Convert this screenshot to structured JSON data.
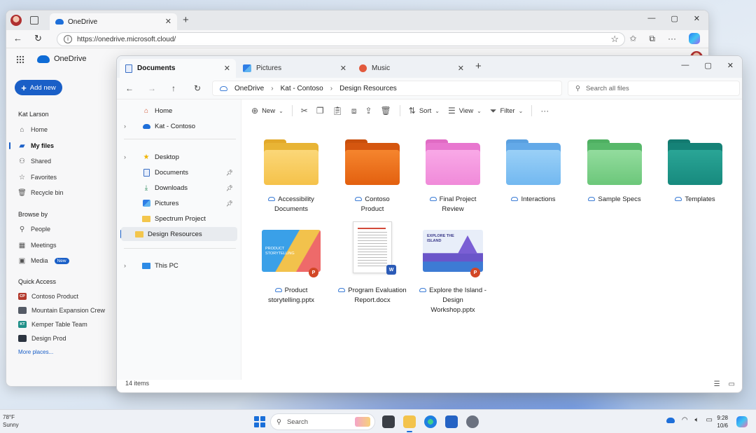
{
  "browser": {
    "tab_title": "OneDrive",
    "url": "https://onedrive.microsoft.cloud/",
    "new_tab": "+",
    "window_controls": [
      "—",
      "▢",
      "✕"
    ]
  },
  "onedrive": {
    "app_name": "OneDrive",
    "add_new": "Add new",
    "user_name": "Kat Larson",
    "nav": [
      {
        "label": "Home",
        "icon": "home-icon"
      },
      {
        "label": "My files",
        "icon": "folder-icon"
      },
      {
        "label": "Shared",
        "icon": "people-icon"
      },
      {
        "label": "Favorites",
        "icon": "star-icon"
      },
      {
        "label": "Recycle bin",
        "icon": "trash-icon"
      }
    ],
    "browse_by_title": "Browse by",
    "browse_by": [
      {
        "label": "People",
        "icon": "person-icon"
      },
      {
        "label": "Meetings",
        "icon": "calendar-icon"
      },
      {
        "label": "Media",
        "icon": "image-icon",
        "badge": "New"
      }
    ],
    "quick_access_title": "Quick Access",
    "quick_access": [
      {
        "label": "Contoso Product",
        "initials": "CP",
        "color": "#b2392c"
      },
      {
        "label": "Mountain Expansion Crew",
        "initials": "",
        "color": "#555b66"
      },
      {
        "label": "Kemper Table Team",
        "initials": "KT",
        "color": "#1f8f88"
      },
      {
        "label": "Design Prod",
        "initials": "",
        "color": "#2c3440"
      }
    ],
    "more_places": "More places..."
  },
  "explorer": {
    "tabs": [
      {
        "label": "Documents",
        "icon": "document-icon"
      },
      {
        "label": "Pictures",
        "icon": "pictures-icon"
      },
      {
        "label": "Music",
        "icon": "music-icon"
      }
    ],
    "breadcrumb": [
      "OneDrive",
      "Kat - Contoso",
      "Design Resources"
    ],
    "search_placeholder": "Search all files",
    "toolbar": {
      "new": "New",
      "sort": "Sort",
      "view": "View",
      "filter": "Filter",
      "more": "···"
    },
    "sidebar": {
      "home": "Home",
      "account": "Kat - Contoso",
      "desktop": "Desktop",
      "documents": "Documents",
      "downloads": "Downloads",
      "pictures": "Pictures",
      "spectrum": "Spectrum Project",
      "design_resources": "Design Resources",
      "this_pc": "This PC"
    },
    "folders": [
      {
        "line1": "Accessibility",
        "line2": "Documents",
        "color": "#f6c650"
      },
      {
        "line1": "Contoso",
        "line2": "Product",
        "color": "#e9661a"
      },
      {
        "line1": "Final Project",
        "line2": "Review",
        "color": "#f28ad8"
      },
      {
        "line1": "Interactions",
        "line2": "",
        "color": "#6fb4f0"
      },
      {
        "line1": "Sample Specs",
        "line2": "",
        "color": "#6cc77a"
      },
      {
        "line1": "Templates",
        "line2": "",
        "color": "#1b8f83"
      }
    ],
    "files": [
      {
        "line1": "Product",
        "line2": "storytelling.pptx",
        "line3": "",
        "thumb_text": "PRODUCT STORYTELLING",
        "app": "P"
      },
      {
        "line1": "Program Evaluation",
        "line2": "Report.docx",
        "line3": "",
        "app": "W"
      },
      {
        "line1": "Explore the Island -",
        "line2": "Design",
        "line3": "Workshop.pptx",
        "thumb_text": "EXPLORE THE ISLAND",
        "app": "P"
      }
    ],
    "status": "14 items"
  },
  "taskbar": {
    "temp": "78°F",
    "weather": "Sunny",
    "search": "Search",
    "time": "9:28",
    "date": "10/6"
  }
}
